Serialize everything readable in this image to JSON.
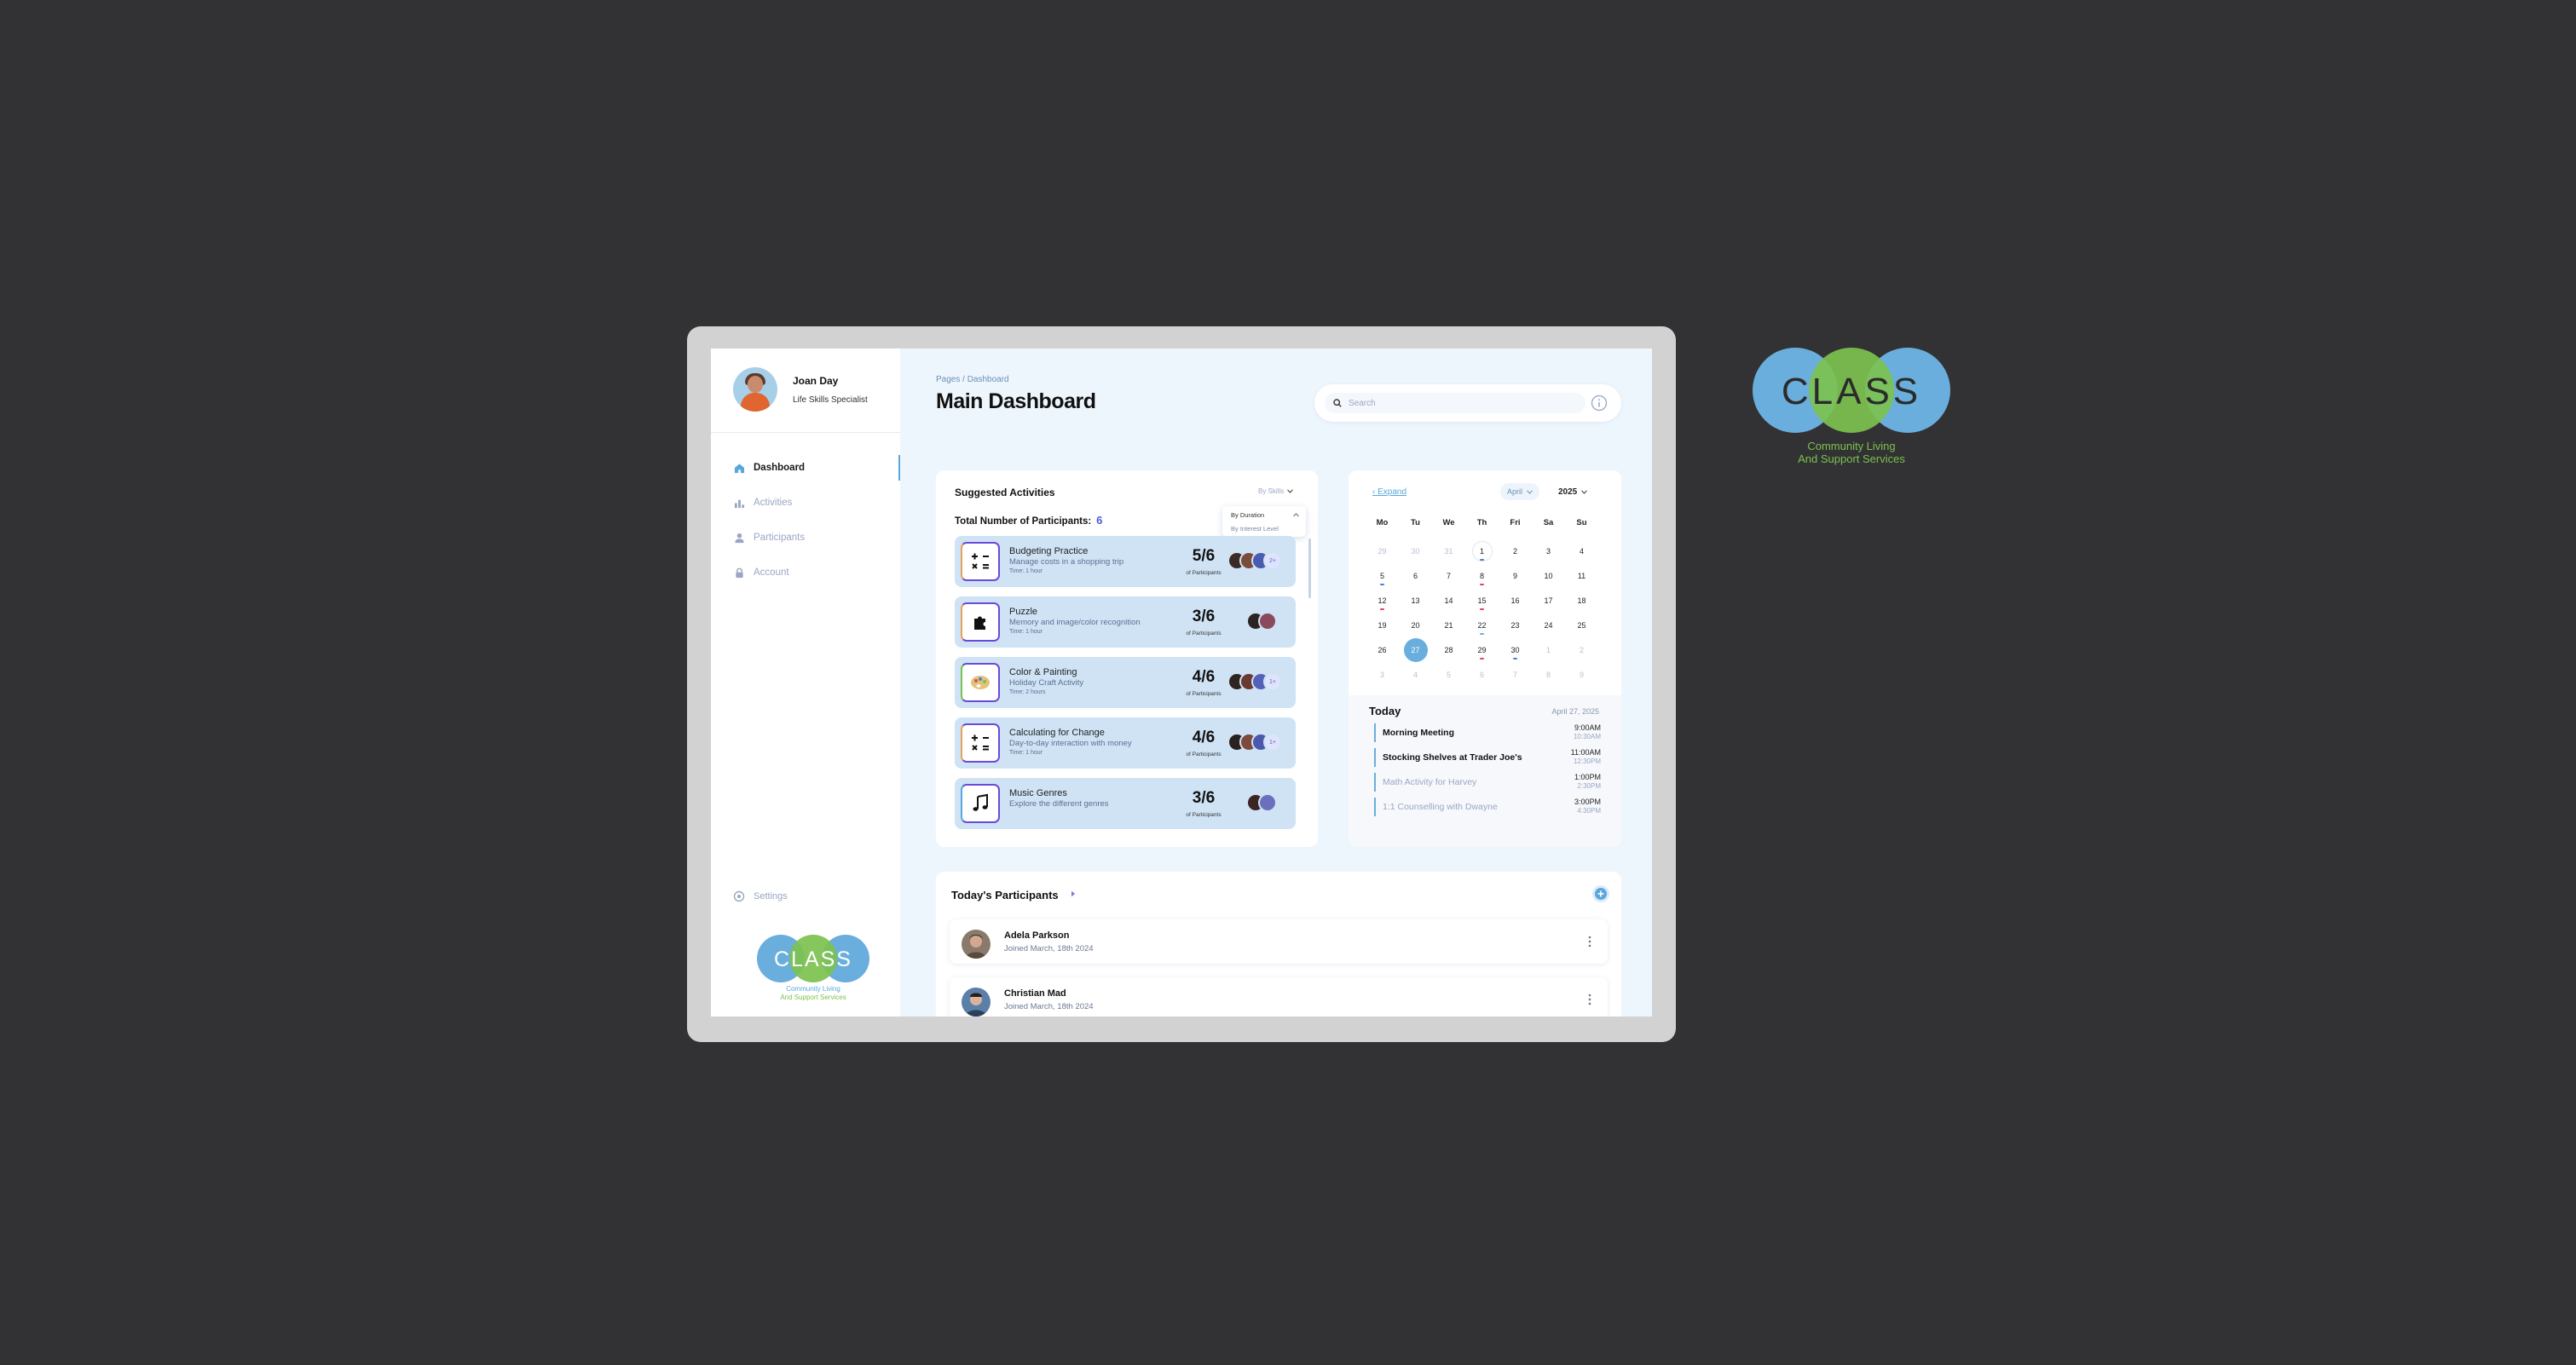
{
  "user": {
    "name": "Joan Day",
    "role": "Life Skills Specialist"
  },
  "nav": [
    {
      "label": "Dashboard",
      "icon": "home-icon",
      "active": true
    },
    {
      "label": "Activities",
      "icon": "bar-chart-icon",
      "active": false
    },
    {
      "label": "Participants",
      "icon": "person-icon",
      "active": false
    },
    {
      "label": "Account",
      "icon": "lock-icon",
      "active": false
    }
  ],
  "settings_label": "Settings",
  "logo": {
    "text": "CLASS",
    "tagline_1": "Community Living",
    "tagline_2": "And Support Services"
  },
  "header": {
    "breadcrumb": "Pages / Dashboard",
    "title": "Main Dashboard"
  },
  "search": {
    "placeholder": "Search",
    "value": ""
  },
  "suggested": {
    "title": "Suggested Activities",
    "filter_label": "By Skills",
    "dropdown_options": [
      "By Duration",
      "By Interest Level"
    ],
    "total_label": "Total Number of Participants:",
    "total_value": "6",
    "participants_caption": "of Participants",
    "activities": [
      {
        "name": "Budgeting Practice",
        "desc": "Manage costs in a shopping trip",
        "time": "Time: 1 hour",
        "count": "5/6",
        "avatars": 3,
        "more": "2+",
        "icon": "calculator-icon"
      },
      {
        "name": "Puzzle",
        "desc": "Memory and image/color recognition",
        "time": "Time: 1 hour",
        "count": "3/6",
        "avatars": 2,
        "more": "",
        "icon": "puzzle-icon"
      },
      {
        "name": "Color & Painting",
        "desc": "Holiday Craft Activity",
        "time": "Time: 2 hours",
        "count": "4/6",
        "avatars": 3,
        "more": "1+",
        "icon": "palette-icon"
      },
      {
        "name": "Calculating for Change",
        "desc": "Day-to-day interaction with money",
        "time": "Time: 1 hour",
        "count": "4/6",
        "avatars": 3,
        "more": "1+",
        "icon": "calculator-icon"
      },
      {
        "name": "Music Genres",
        "desc": "Explore the different genres",
        "time": "",
        "count": "3/6",
        "avatars": 2,
        "more": "",
        "icon": "music-note-icon"
      }
    ]
  },
  "calendar": {
    "expand_label": "‹ Expand",
    "month": "April",
    "year": "2025",
    "weekdays": [
      "Mo",
      "Tu",
      "We",
      "Th",
      "Fri",
      "Sa",
      "Su"
    ],
    "days": [
      {
        "d": "29",
        "m": true
      },
      {
        "d": "30",
        "m": true
      },
      {
        "d": "31",
        "m": true
      },
      {
        "d": "1",
        "o": true,
        "dot": "#4a7fd6"
      },
      {
        "d": "2"
      },
      {
        "d": "3"
      },
      {
        "d": "4"
      },
      {
        "d": "5",
        "dot": "#4a7fd6"
      },
      {
        "d": "6"
      },
      {
        "d": "7"
      },
      {
        "d": "8",
        "dot": "#e0445a"
      },
      {
        "d": "9"
      },
      {
        "d": "10"
      },
      {
        "d": "11"
      },
      {
        "d": "12",
        "dot": "#e0445a"
      },
      {
        "d": "13"
      },
      {
        "d": "14"
      },
      {
        "d": "15",
        "dot": "#e0445a"
      },
      {
        "d": "16"
      },
      {
        "d": "17"
      },
      {
        "d": "18"
      },
      {
        "d": "19"
      },
      {
        "d": "20"
      },
      {
        "d": "21"
      },
      {
        "d": "22",
        "dot": "#6aaedd"
      },
      {
        "d": "23"
      },
      {
        "d": "24"
      },
      {
        "d": "25"
      },
      {
        "d": "26"
      },
      {
        "d": "27",
        "t": true
      },
      {
        "d": "28"
      },
      {
        "d": "29",
        "dot": "#e0445a"
      },
      {
        "d": "30",
        "dot": "#4a7fd6"
      },
      {
        "d": "1",
        "m": true
      },
      {
        "d": "2",
        "m": true
      },
      {
        "d": "3",
        "m": true
      },
      {
        "d": "4",
        "m": true
      },
      {
        "d": "5",
        "m": true
      },
      {
        "d": "6",
        "m": true
      },
      {
        "d": "7",
        "m": true
      },
      {
        "d": "8",
        "m": true
      },
      {
        "d": "9",
        "m": true
      }
    ]
  },
  "today": {
    "title": "Today",
    "date": "April 27, 2025",
    "events": [
      {
        "title": "Morning Meeting",
        "start": "9:00AM",
        "end": "10:30AM",
        "past": false
      },
      {
        "title": "Stocking Shelves at Trader Joe's",
        "start": "11:00AM",
        "end": "12:30PM",
        "past": false
      },
      {
        "title": "Math Activity for Harvey",
        "start": "1:00PM",
        "end": "2:30PM",
        "past": true
      },
      {
        "title": "1:1 Counselling with Dwayne",
        "start": "3:00PM",
        "end": "4:30PM",
        "past": true
      }
    ]
  },
  "participants": {
    "title": "Today's Participants",
    "list": [
      {
        "name": "Adela Parkson",
        "joined": "Joined March, 18th 2024"
      },
      {
        "name": "Christian Mad",
        "joined": "Joined March, 18th 2024"
      }
    ]
  },
  "colors": {
    "accent": "#5aa7dc",
    "logo_blue": "#6aaedd",
    "logo_green": "#7cc14f",
    "activity_row": "#cfe3f5"
  }
}
